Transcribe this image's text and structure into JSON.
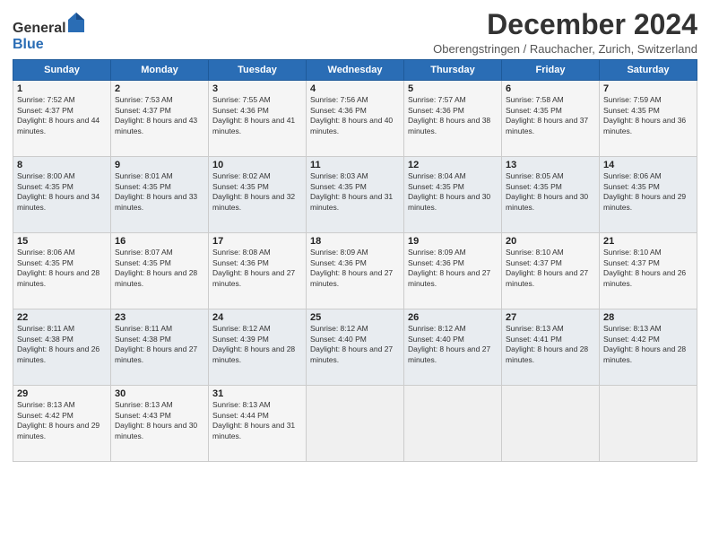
{
  "header": {
    "logo_general": "General",
    "logo_blue": "Blue",
    "month_title": "December 2024",
    "subtitle": "Oberengstringen / Rauchacher, Zurich, Switzerland"
  },
  "weekdays": [
    "Sunday",
    "Monday",
    "Tuesday",
    "Wednesday",
    "Thursday",
    "Friday",
    "Saturday"
  ],
  "weeks": [
    [
      {
        "day": 1,
        "sunrise": "7:52 AM",
        "sunset": "4:37 PM",
        "daylight": "8 hours and 44 minutes."
      },
      {
        "day": 2,
        "sunrise": "7:53 AM",
        "sunset": "4:37 PM",
        "daylight": "8 hours and 43 minutes."
      },
      {
        "day": 3,
        "sunrise": "7:55 AM",
        "sunset": "4:36 PM",
        "daylight": "8 hours and 41 minutes."
      },
      {
        "day": 4,
        "sunrise": "7:56 AM",
        "sunset": "4:36 PM",
        "daylight": "8 hours and 40 minutes."
      },
      {
        "day": 5,
        "sunrise": "7:57 AM",
        "sunset": "4:36 PM",
        "daylight": "8 hours and 38 minutes."
      },
      {
        "day": 6,
        "sunrise": "7:58 AM",
        "sunset": "4:35 PM",
        "daylight": "8 hours and 37 minutes."
      },
      {
        "day": 7,
        "sunrise": "7:59 AM",
        "sunset": "4:35 PM",
        "daylight": "8 hours and 36 minutes."
      }
    ],
    [
      {
        "day": 8,
        "sunrise": "8:00 AM",
        "sunset": "4:35 PM",
        "daylight": "8 hours and 34 minutes."
      },
      {
        "day": 9,
        "sunrise": "8:01 AM",
        "sunset": "4:35 PM",
        "daylight": "8 hours and 33 minutes."
      },
      {
        "day": 10,
        "sunrise": "8:02 AM",
        "sunset": "4:35 PM",
        "daylight": "8 hours and 32 minutes."
      },
      {
        "day": 11,
        "sunrise": "8:03 AM",
        "sunset": "4:35 PM",
        "daylight": "8 hours and 31 minutes."
      },
      {
        "day": 12,
        "sunrise": "8:04 AM",
        "sunset": "4:35 PM",
        "daylight": "8 hours and 30 minutes."
      },
      {
        "day": 13,
        "sunrise": "8:05 AM",
        "sunset": "4:35 PM",
        "daylight": "8 hours and 30 minutes."
      },
      {
        "day": 14,
        "sunrise": "8:06 AM",
        "sunset": "4:35 PM",
        "daylight": "8 hours and 29 minutes."
      }
    ],
    [
      {
        "day": 15,
        "sunrise": "8:06 AM",
        "sunset": "4:35 PM",
        "daylight": "8 hours and 28 minutes."
      },
      {
        "day": 16,
        "sunrise": "8:07 AM",
        "sunset": "4:35 PM",
        "daylight": "8 hours and 28 minutes."
      },
      {
        "day": 17,
        "sunrise": "8:08 AM",
        "sunset": "4:36 PM",
        "daylight": "8 hours and 27 minutes."
      },
      {
        "day": 18,
        "sunrise": "8:09 AM",
        "sunset": "4:36 PM",
        "daylight": "8 hours and 27 minutes."
      },
      {
        "day": 19,
        "sunrise": "8:09 AM",
        "sunset": "4:36 PM",
        "daylight": "8 hours and 27 minutes."
      },
      {
        "day": 20,
        "sunrise": "8:10 AM",
        "sunset": "4:37 PM",
        "daylight": "8 hours and 27 minutes."
      },
      {
        "day": 21,
        "sunrise": "8:10 AM",
        "sunset": "4:37 PM",
        "daylight": "8 hours and 26 minutes."
      }
    ],
    [
      {
        "day": 22,
        "sunrise": "8:11 AM",
        "sunset": "4:38 PM",
        "daylight": "8 hours and 26 minutes."
      },
      {
        "day": 23,
        "sunrise": "8:11 AM",
        "sunset": "4:38 PM",
        "daylight": "8 hours and 27 minutes."
      },
      {
        "day": 24,
        "sunrise": "8:12 AM",
        "sunset": "4:39 PM",
        "daylight": "8 hours and 28 minutes."
      },
      {
        "day": 25,
        "sunrise": "8:12 AM",
        "sunset": "4:40 PM",
        "daylight": "8 hours and 27 minutes."
      },
      {
        "day": 26,
        "sunrise": "8:12 AM",
        "sunset": "4:40 PM",
        "daylight": "8 hours and 27 minutes."
      },
      {
        "day": 27,
        "sunrise": "8:13 AM",
        "sunset": "4:41 PM",
        "daylight": "8 hours and 28 minutes."
      },
      {
        "day": 28,
        "sunrise": "8:13 AM",
        "sunset": "4:42 PM",
        "daylight": "8 hours and 28 minutes."
      }
    ],
    [
      {
        "day": 29,
        "sunrise": "8:13 AM",
        "sunset": "4:42 PM",
        "daylight": "8 hours and 29 minutes."
      },
      {
        "day": 30,
        "sunrise": "8:13 AM",
        "sunset": "4:43 PM",
        "daylight": "8 hours and 30 minutes."
      },
      {
        "day": 31,
        "sunrise": "8:13 AM",
        "sunset": "4:44 PM",
        "daylight": "8 hours and 31 minutes."
      },
      null,
      null,
      null,
      null
    ]
  ]
}
